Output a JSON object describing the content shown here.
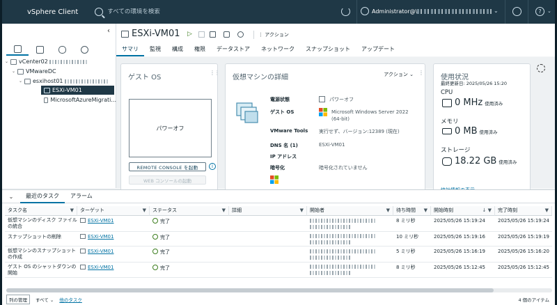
{
  "topbar": {
    "app_title": "vSphere Client",
    "search_placeholder": "すべての環境を検索",
    "user_name": "Administrator@\\"
  },
  "tree": [
    {
      "label": "vCenter02"
    },
    {
      "label": "VMwareDC"
    },
    {
      "label": "esxihost01"
    },
    {
      "label": "ESXi-VM01"
    },
    {
      "label": "MicrosoftAzureMigrati..."
    }
  ],
  "vm": {
    "title": "ESXi-VM01",
    "actions_label": "アクション",
    "tabs": [
      "サマリ",
      "監視",
      "構成",
      "権限",
      "データストア",
      "ネットワーク",
      "スナップショット",
      "アップデート"
    ]
  },
  "guest_os_card": {
    "title": "ゲスト OS",
    "console_text": "パワーオフ",
    "remote_console_button": "REMOTE CONSOLE を起動",
    "web_console_button": "WEB コンソールの起動"
  },
  "details_card": {
    "title": "仮想マシンの詳細",
    "actions_label": "アクション",
    "rows": [
      {
        "key": "電源状態",
        "value": "パワーオフ"
      },
      {
        "key": "ゲスト OS",
        "value": "Microsoft Windows Server 2022 (64-bit)"
      },
      {
        "key": "VMware Tools",
        "value": "実行せず、バージョン:12389 (現在)"
      },
      {
        "key": "DNS 名 (1)",
        "value": "ESXi-VM01"
      },
      {
        "key": "IP アドレス",
        "value": ""
      },
      {
        "key": "暗号化",
        "value": "暗号化されていません"
      }
    ]
  },
  "usage_card": {
    "title": "使用状況",
    "last_updated": "最終更新日: 2025/05/26 15:20",
    "cpu_label": "CPU",
    "cpu_value": "0 MHz",
    "cpu_unit": "使用済み",
    "mem_label": "メモリ",
    "mem_value": "0 MB",
    "mem_unit": "使用済み",
    "storage_label": "ストレージ",
    "storage_value": "18.22 GB",
    "storage_unit": "使用済み",
    "link": "統計情報の表示"
  },
  "tasks_panel": {
    "tabs": [
      "最近のタスク",
      "アラーム"
    ],
    "columns": [
      "タスク名",
      "ターゲット",
      "ステータス",
      "詳細",
      "開始者",
      "待ち時間",
      "開始時刻",
      "完了時刻"
    ],
    "rows": [
      {
        "task": "仮想マシンのディスク ファイルの統合",
        "target": "ESXi-VM01",
        "status": "完了",
        "details": "",
        "wait": "8 ミリ秒",
        "start": "2025/05/26 15:19:24",
        "end": "2025/05/26 15:19:24"
      },
      {
        "task": "スナップショットの削除",
        "target": "ESXi-VM01",
        "status": "完了",
        "details": "",
        "wait": "10 ミリ秒",
        "start": "2025/05/26 15:19:16",
        "end": "2025/05/26 15:19:19"
      },
      {
        "task": "仮想マシンのスナップショットの作成",
        "target": "ESXi-VM01",
        "status": "完了",
        "details": "",
        "wait": "5 ミリ秒",
        "start": "2025/05/26 15:16:19",
        "end": "2025/05/26 15:16:20"
      },
      {
        "task": "ゲスト OS のシャットダウンの開始",
        "target": "ESXi-VM01",
        "status": "完了",
        "details": "",
        "wait": "8 ミリ秒",
        "start": "2025/05/26 15:12:45",
        "end": "2025/05/26 15:12:45"
      }
    ],
    "manage_columns": "列の管理",
    "filter": "すべて",
    "more_tasks": "他のタスク",
    "item_count": "4 個のアイテム"
  }
}
